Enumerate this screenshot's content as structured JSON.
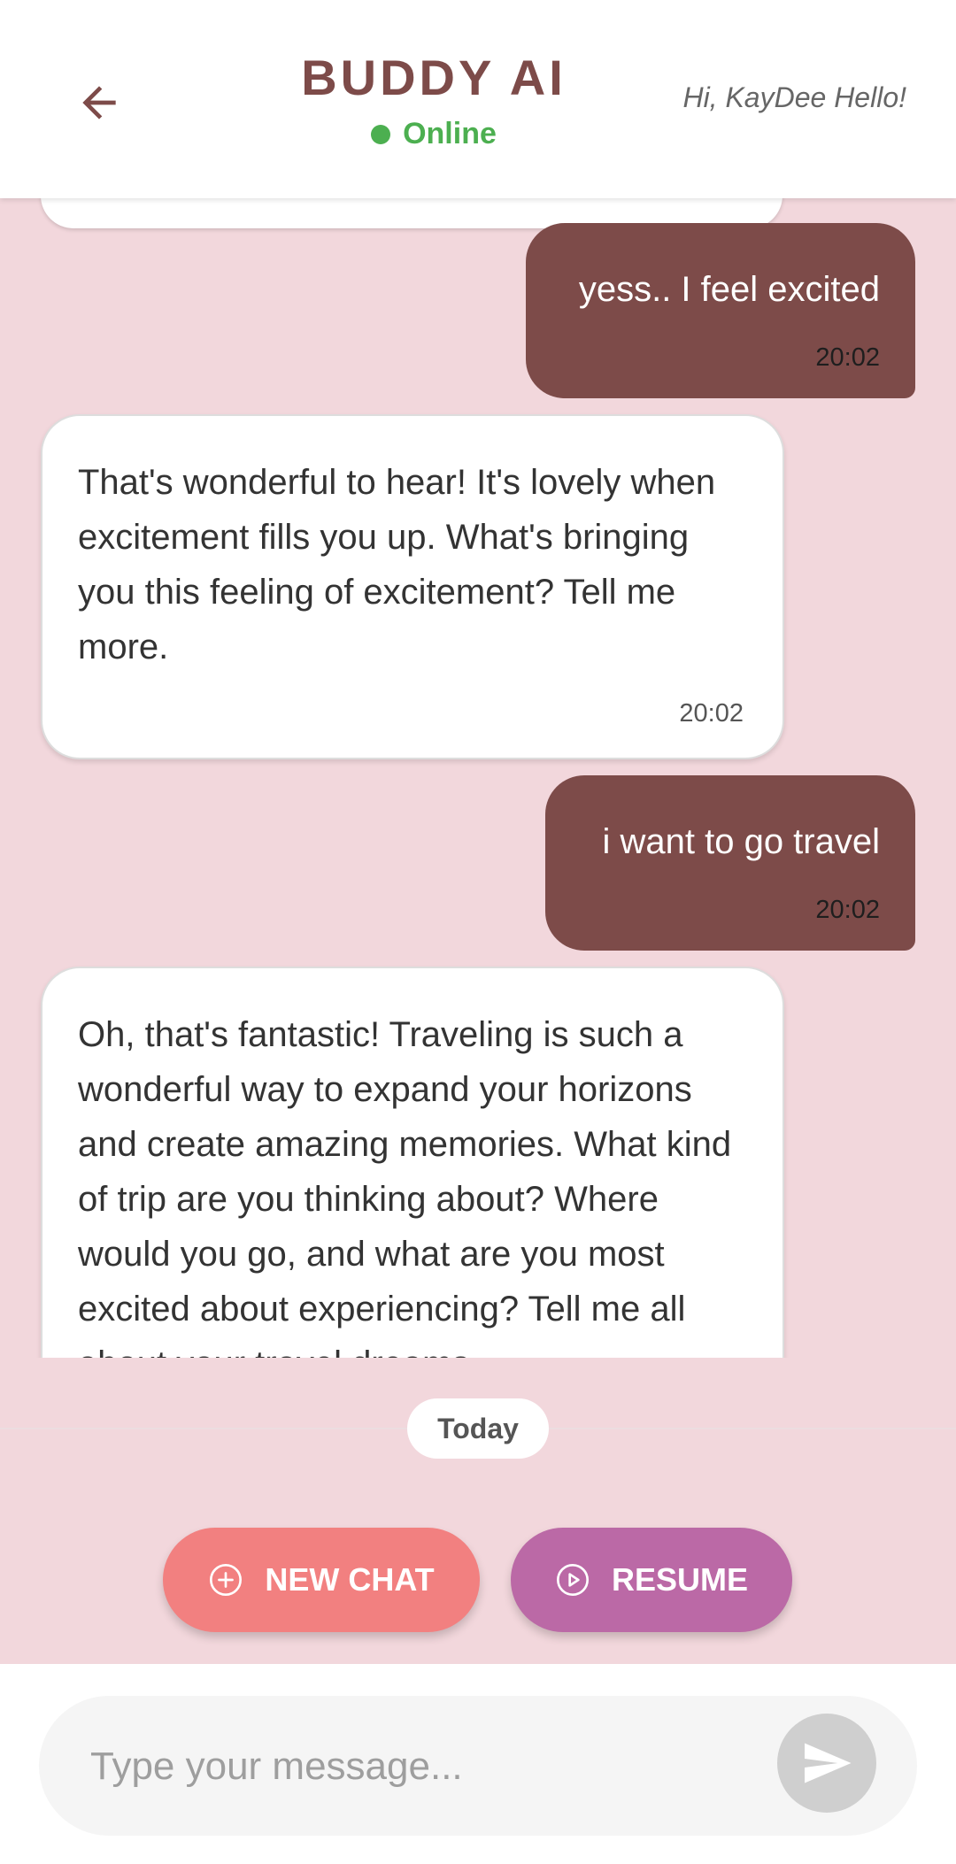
{
  "header": {
    "back_icon": "arrow-left-icon",
    "title": "BUDDY AI",
    "status": "Online",
    "status_color": "#4caf50",
    "greeting": "Hi, KayDee Hello!",
    "accent_color": "#7d4b49"
  },
  "messages": [
    {
      "sender": "user",
      "text": "yess.. I feel excited",
      "time": "20:02"
    },
    {
      "sender": "bot",
      "text": "That's wonderful to hear!  It's lovely when excitement fills you up.  What's bringing you this feeling of excitement?  Tell me more.",
      "time": "20:02"
    },
    {
      "sender": "user",
      "text": "i want to go travel",
      "time": "20:02"
    },
    {
      "sender": "bot",
      "text": "Oh, that's fantastic!  Traveling is such a wonderful way to expand your horizons and create amazing memories.  What kind of trip are you thinking about?  Where would you go, and what are you most excited about experiencing?  Tell me all about your travel dreams."
    }
  ],
  "divider": {
    "label": "Today"
  },
  "actions": {
    "new_chat_label": "NEW CHAT",
    "new_chat_icon": "plus-circle-icon",
    "new_chat_color": "#f28080",
    "resume_label": "RESUME",
    "resume_icon": "play-circle-icon",
    "resume_color": "#bb69a6"
  },
  "composer": {
    "placeholder": "Type your message...",
    "value": "",
    "send_icon": "send-icon"
  }
}
